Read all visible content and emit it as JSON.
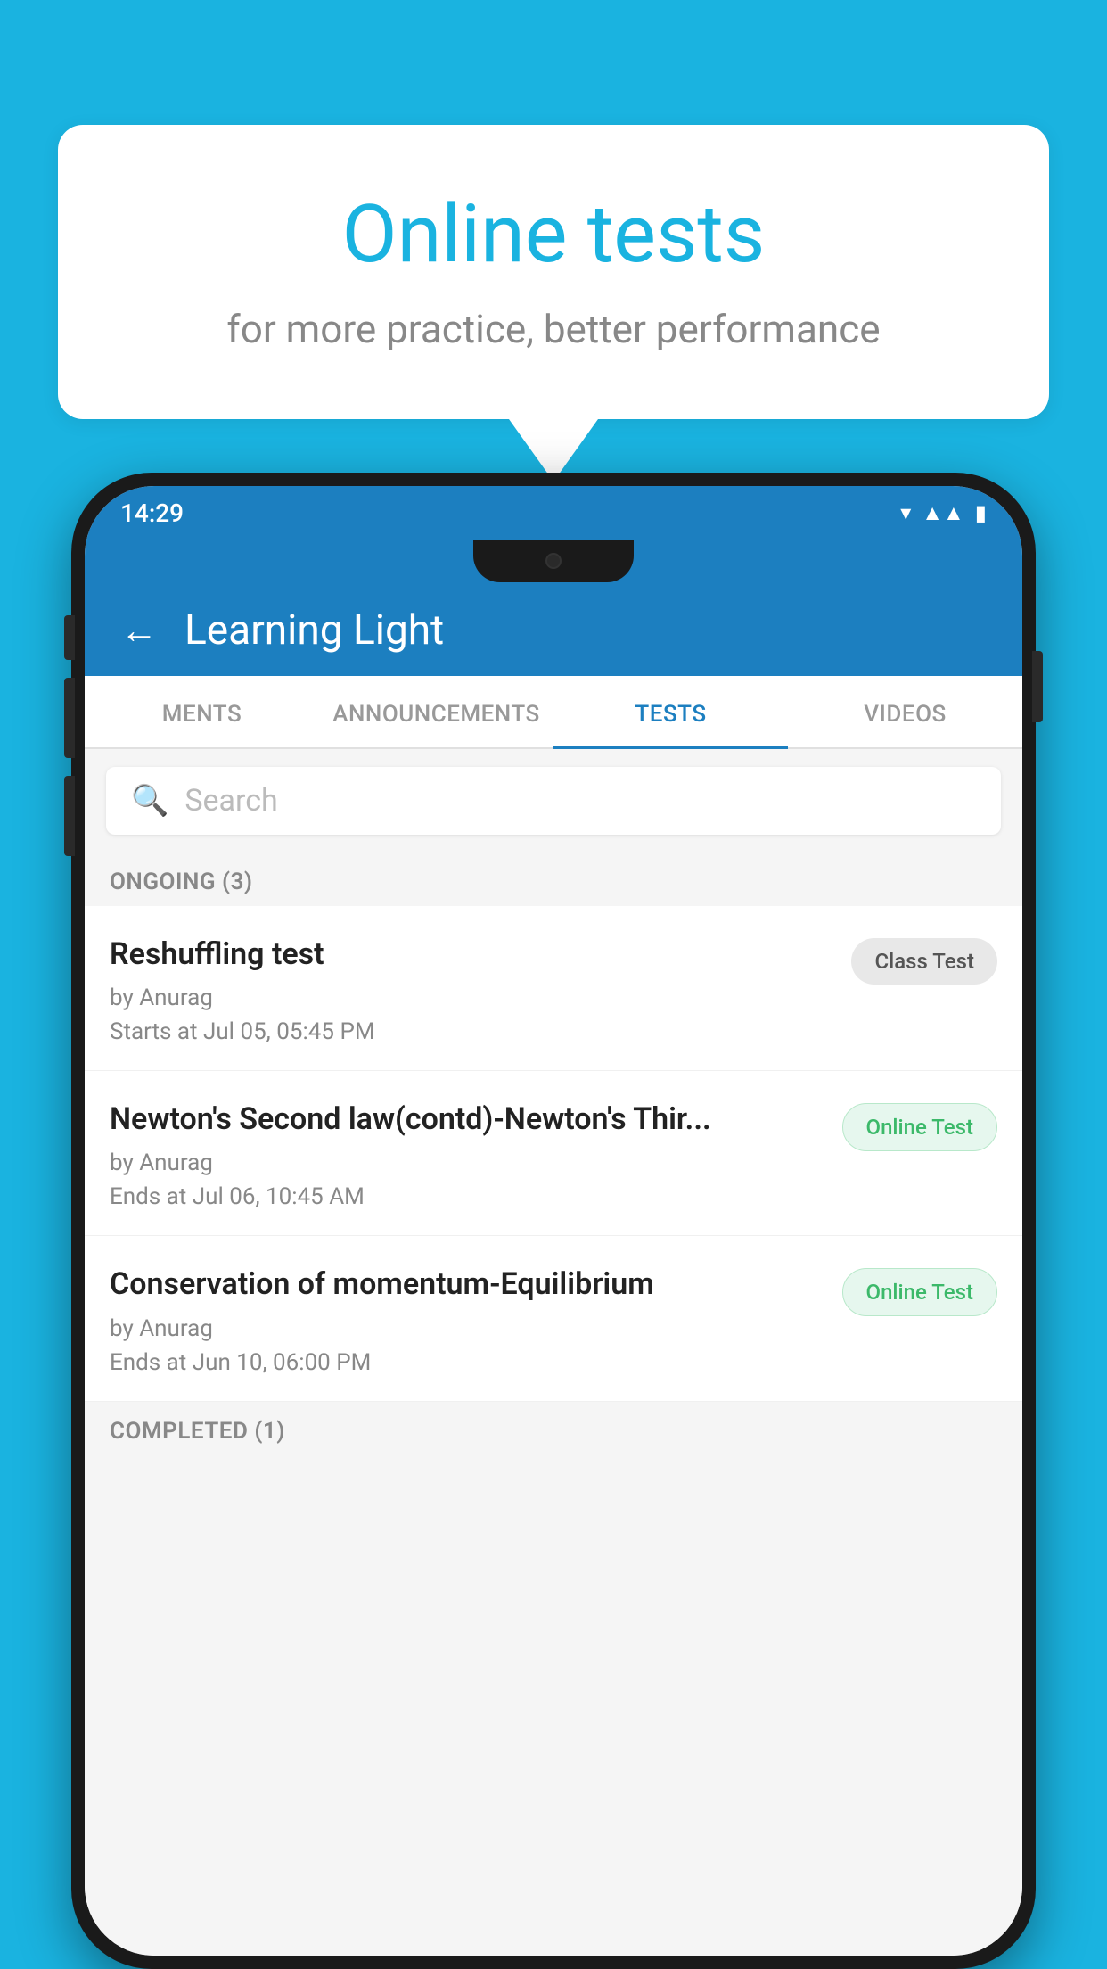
{
  "background_color": "#1ab3e0",
  "speech_bubble": {
    "title": "Online tests",
    "subtitle": "for more practice, better performance"
  },
  "phone": {
    "status_bar": {
      "time": "14:29",
      "icons": [
        "wifi",
        "signal",
        "battery"
      ]
    },
    "header": {
      "back_label": "←",
      "title": "Learning Light"
    },
    "tabs": [
      {
        "label": "MENTS",
        "active": false
      },
      {
        "label": "ANNOUNCEMENTS",
        "active": false
      },
      {
        "label": "TESTS",
        "active": true
      },
      {
        "label": "VIDEOS",
        "active": false
      }
    ],
    "search": {
      "placeholder": "Search"
    },
    "ongoing_section": {
      "title": "ONGOING (3)",
      "tests": [
        {
          "name": "Reshuffling test",
          "author": "by Anurag",
          "time": "Starts at  Jul 05, 05:45 PM",
          "badge": "Class Test",
          "badge_type": "class"
        },
        {
          "name": "Newton's Second law(contd)-Newton's Thir...",
          "author": "by Anurag",
          "time": "Ends at  Jul 06, 10:45 AM",
          "badge": "Online Test",
          "badge_type": "online"
        },
        {
          "name": "Conservation of momentum-Equilibrium",
          "author": "by Anurag",
          "time": "Ends at  Jun 10, 06:00 PM",
          "badge": "Online Test",
          "badge_type": "online"
        }
      ]
    },
    "completed_section": {
      "title": "COMPLETED (1)"
    }
  }
}
